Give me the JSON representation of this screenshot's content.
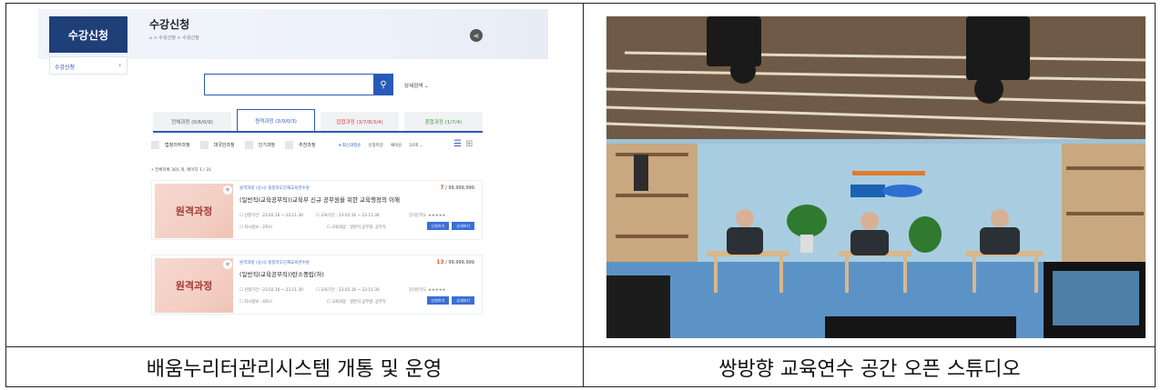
{
  "captions": {
    "left": "배움누리터관리시스템 개통 및 운영",
    "right": "쌍방향 교육연수 공간 오픈 스튜디오"
  },
  "screenshot": {
    "sidebar_title": "수강신청",
    "sidebar_item": "수강신청",
    "page_title": "수강신청",
    "breadcrumb": "⌂  >  수강신청  >  수강신청",
    "advanced_search": "상세검색 ⌄",
    "tabs": [
      {
        "label": "전체과정 (0/6/0/9)",
        "color": "#555555"
      },
      {
        "label": "원격과정 (3/0/0/3)",
        "color": "#2a5ab8"
      },
      {
        "label": "집합과정 (3/7/8/3/4)",
        "color": "#d63c3c"
      },
      {
        "label": "혼합과정 (1/7/4)",
        "color": "#3a9a3a"
      }
    ],
    "filters": [
      "법정의무과정",
      "대국민과정",
      "인기과정",
      "추천과정"
    ],
    "sorts": [
      "▾ 최신과정순",
      "신청마감",
      "예비순",
      "10개 ⌄"
    ],
    "total": "• 전체목록 301 개, 페이지 1 / 31",
    "courses": [
      {
        "thumb": "원격과정",
        "meta": "원격과정 (상시)  충청북도단재교육연수원",
        "count": "7",
        "count_total": " / 99,999,999",
        "title": "(일반직(교육공무직))교육부 신규 공무원을 위한 교육행정의 이해",
        "period": "☐ 신청기간 : 23.02.16 ~ 23.11.30",
        "study": "☐ 교육기간 : 23.02.16 ~ 23.11.30",
        "rating_label": "강의만족도",
        "rating": "★★★★★",
        "hours": "☐ 차시정보 : 2차시",
        "target": "☐ 교육대상 : 일반직 공무원, 공무직",
        "btn_apply": "신청하기",
        "btn_detail": "상세보기"
      },
      {
        "thumb": "원격과정",
        "meta": "원격과정 (상시)  충청북도단재교육연수원",
        "count": "13",
        "count_total": " / 99,999,999",
        "title": "(일반직(교육공무직))탄소중립(하)",
        "period": "☐ 신청기간 : 23.02.16 ~ 23.11.30",
        "study": "☐ 교육기간 : 23.02.16 ~ 23.11.30",
        "rating_label": "강의만족도",
        "rating": "★★★★★",
        "hours": "☐ 차시정보 : 4차시",
        "target": "☐ 교육대상 : 일반직 공무원, 공무직",
        "btn_apply": "신청하기",
        "btn_detail": "상세보기"
      }
    ]
  }
}
